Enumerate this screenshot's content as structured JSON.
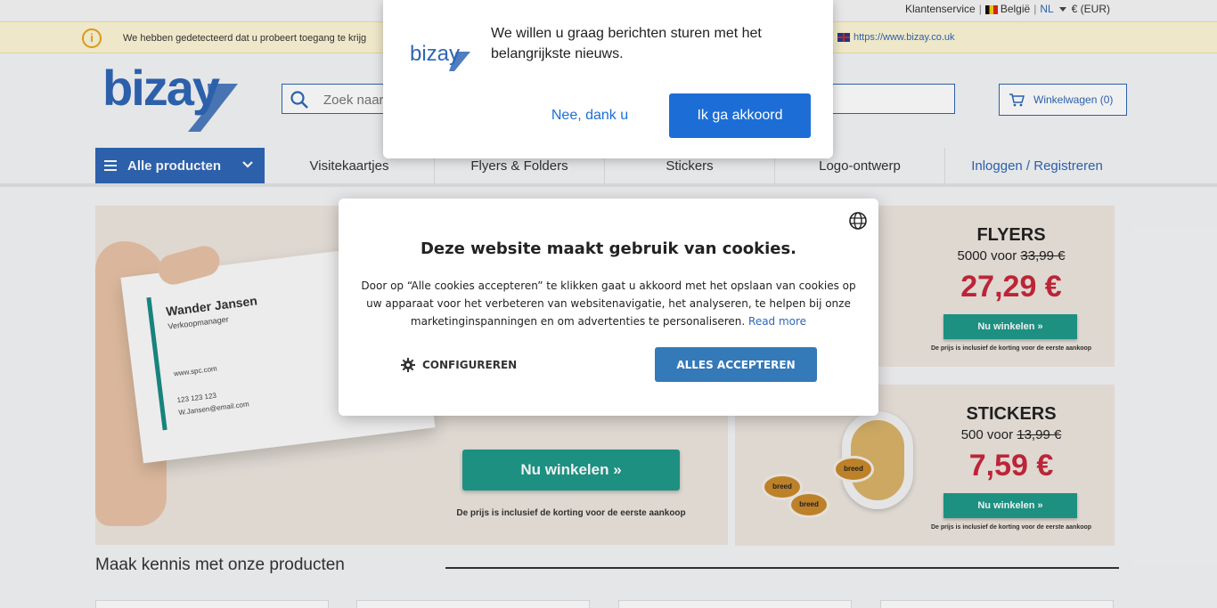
{
  "topbar": {
    "service": "Klantenservice",
    "country": "België",
    "language": "NL",
    "currency": "€ (EUR)"
  },
  "warning": {
    "message": "We hebben gedetecteerd dat u probeert toegang te krijg",
    "uk_link": "https://www.bizay.co.uk"
  },
  "header": {
    "logo_text": "bizay",
    "search_placeholder": "Zoek naar",
    "cart_label": "Winkelwagen (0)"
  },
  "nav": {
    "all_products": "Alle producten",
    "items": [
      "Visitekaartjes",
      "Flyers & Folders",
      "Stickers",
      "Logo-ontwerp"
    ],
    "login": "Inloggen / Registreren"
  },
  "hero": {
    "card": {
      "name": "Wander Jansen",
      "role": "Verkoopmanager",
      "website": "www.spc.com",
      "phone": "123 123 123",
      "email": "W.Jansen@email.com"
    },
    "button": "Nu winkelen »",
    "note": "De prijs is inclusief de korting voor de eerste aankoop"
  },
  "promos": [
    {
      "title": "FLYERS",
      "qty": "5000 voor",
      "old_price": "33,99 €",
      "price": "27,29 €",
      "button": "Nu winkelen »",
      "note": "De prijs is inclusief de korting voor de eerste aankoop"
    },
    {
      "title": "STICKERS",
      "qty": "500 voor",
      "old_price": "13,99 €",
      "price": "7,59 €",
      "button": "Nu winkelen »",
      "note": "De prijs is inclusief de korting voor de eerste aankoop"
    }
  ],
  "section": {
    "title": "Maak kennis met onze producten"
  },
  "push_prompt": {
    "logo_text": "bizay",
    "message": "We willen u graag berichten sturen met het belangrijkste nieuws.",
    "decline": "Nee, dank u",
    "accept": "Ik ga akkoord"
  },
  "cookie": {
    "title": "Deze website maakt gebruik van cookies.",
    "body": "Door op “Alle cookies accepteren” te klikken gaat u akkoord met het opslaan van cookies op uw apparaat voor het verbeteren van websitenavigatie, het analyseren, te helpen bij onze marketinginspanningen en om advertenties te personaliseren.",
    "read_more": "Read more",
    "configure": "CONFIGUREREN",
    "accept_all": "ALLES ACCEPTEREN"
  },
  "colors": {
    "brand_blue": "#2f66b5",
    "teal": "#1f9a8a",
    "price_red": "#c8283b",
    "push_blue": "#1c6ed6"
  }
}
